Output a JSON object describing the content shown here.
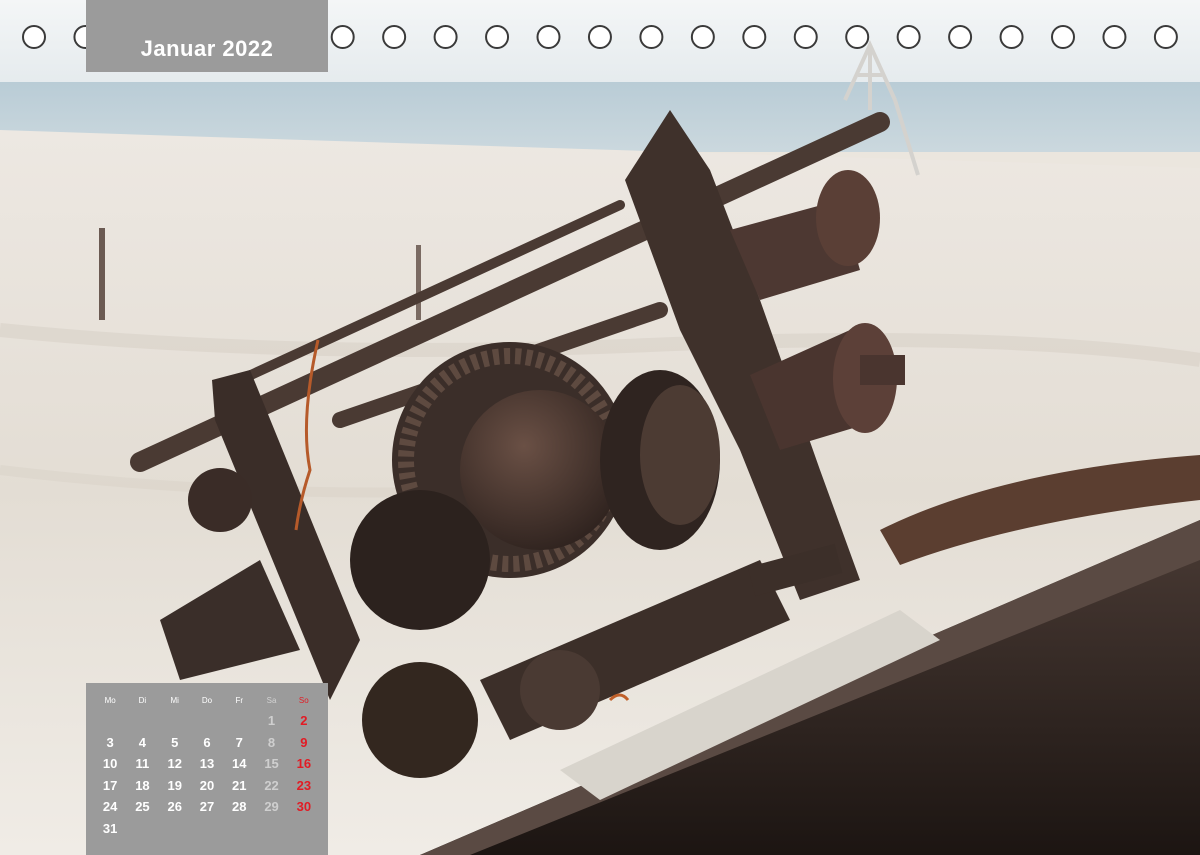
{
  "calendar": {
    "month_title": "Januar 2022",
    "weekdays": [
      "Mo",
      "Di",
      "Mi",
      "Do",
      "Fr",
      "Sa",
      "So"
    ],
    "weeks": [
      [
        "",
        "",
        "",
        "",
        "",
        "1",
        "2"
      ],
      [
        "3",
        "4",
        "5",
        "6",
        "7",
        "8",
        "9"
      ],
      [
        "10",
        "11",
        "12",
        "13",
        "14",
        "15",
        "16"
      ],
      [
        "17",
        "18",
        "19",
        "20",
        "21",
        "22",
        "23"
      ],
      [
        "24",
        "25",
        "26",
        "27",
        "28",
        "29",
        "30"
      ],
      [
        "31",
        "",
        "",
        "",
        "",
        "",
        ""
      ]
    ]
  },
  "colors": {
    "panel": "#9b9b9b",
    "sunday": "#e21b24",
    "saturday": "#cfcfcf",
    "text": "#ffffff"
  },
  "photo": {
    "subject": "rusted-winch-on-shipwreck-at-beach"
  }
}
